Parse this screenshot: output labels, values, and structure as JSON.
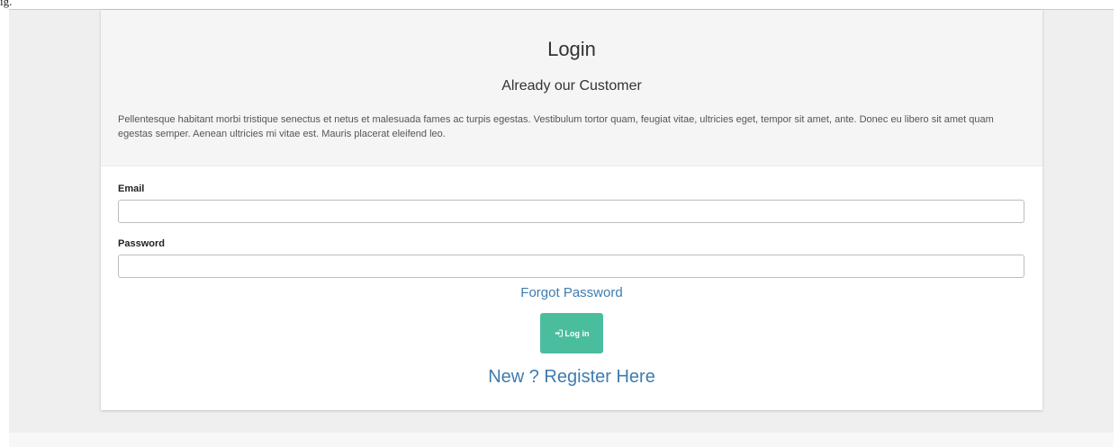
{
  "page": {
    "corner_label": "ig."
  },
  "login": {
    "title": "Login",
    "subtitle": "Already our Customer",
    "intro": "Pellentesque habitant morbi tristique senectus et netus et malesuada fames ac turpis egestas. Vestibulum tortor quam, feugiat vitae, ultricies eget, tempor sit amet, ante. Donec eu libero sit amet quam egestas semper. Aenean ultricies mi vitae est. Mauris placerat eleifend leo.",
    "email": {
      "label": "Email",
      "value": "",
      "placeholder": ""
    },
    "password": {
      "label": "Password",
      "value": "",
      "placeholder": ""
    },
    "forgot_password": "Forgot Password",
    "login_button": {
      "label": "Log in",
      "icon": "sign-in-icon"
    },
    "register_link": "New ? Register Here"
  },
  "colors": {
    "accent_button": "#4bbd9f",
    "link": "#3f7bb0",
    "header_background": "#f5f5f5",
    "page_background": "#efefef"
  }
}
